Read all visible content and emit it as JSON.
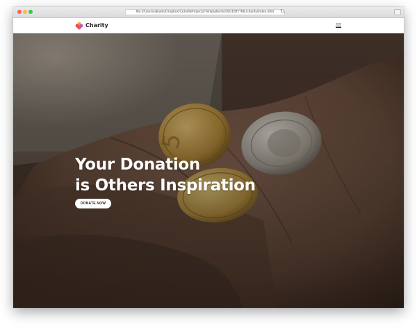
{
  "browser": {
    "url": "file:///Users/alkaris/Dropbox/ColorlibProjects/Templates%202018/HTML/charity/index.html"
  },
  "site": {
    "brand": "Charity",
    "colors": {
      "logo_primary": "#e8364b",
      "logo_secondary": "#f5a623",
      "logo_tertiary": "#9b4dca"
    }
  },
  "hero": {
    "title_line1": "Your Donation",
    "title_line2": "is Others Inspiration",
    "cta_label": "DONATE NOW"
  },
  "icons": {
    "logo": "charity-logo-icon",
    "menu": "hamburger-menu-icon",
    "reload": "reload-icon"
  }
}
